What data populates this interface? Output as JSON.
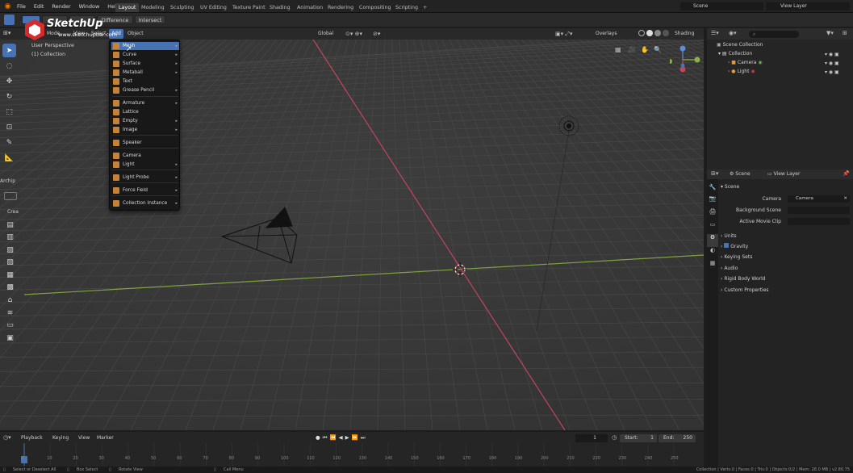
{
  "menubar": {
    "items": [
      "File",
      "Edit",
      "Render",
      "Window",
      "Help"
    ]
  },
  "workspace_tabs": [
    "Layout",
    "Modeling",
    "Sculpting",
    "UV Editing",
    "Texture Paint",
    "Shading",
    "Animation",
    "Rendering",
    "Compositing",
    "Scripting",
    "+"
  ],
  "scene": {
    "label": "Scene",
    "view_layer": "View Layer"
  },
  "toolrow": {
    "bool_buttons": [
      "Difference",
      "Intersect"
    ]
  },
  "logo": {
    "brand": "SketchUp",
    "url": "www.sketchupbar.com"
  },
  "viewport_header": {
    "mode": "Mode",
    "menus": [
      "View",
      "Select",
      "Add",
      "Object"
    ],
    "transform": "Global",
    "overlays": "Overlays",
    "shading": "Shading"
  },
  "viewport": {
    "perspective": "User Perspective",
    "collection": "(1) Collection"
  },
  "side_panels": {
    "arch": "Archip",
    "create": "Crea"
  },
  "add_menu": {
    "items": [
      {
        "label": "Mesh",
        "icon": "mesh-icon",
        "submenu": true,
        "highlight": true
      },
      {
        "label": "Curve",
        "icon": "curve-icon",
        "submenu": true
      },
      {
        "label": "Surface",
        "icon": "surface-icon",
        "submenu": true
      },
      {
        "label": "Metaball",
        "icon": "metaball-icon",
        "submenu": true
      },
      {
        "label": "Text",
        "icon": "text-icon",
        "submenu": false
      },
      {
        "label": "Grease Pencil",
        "icon": "grease-pencil-icon",
        "submenu": true
      },
      {
        "label": "Armature",
        "icon": "armature-icon",
        "submenu": true
      },
      {
        "label": "Lattice",
        "icon": "lattice-icon",
        "submenu": false
      },
      {
        "label": "Empty",
        "icon": "empty-icon",
        "submenu": true
      },
      {
        "label": "Image",
        "icon": "image-icon",
        "submenu": true
      },
      {
        "label": "Speaker",
        "icon": "speaker-icon",
        "submenu": false
      },
      {
        "label": "Camera",
        "icon": "camera-icon",
        "submenu": false
      },
      {
        "label": "Light",
        "icon": "light-icon",
        "submenu": true
      },
      {
        "label": "Light Probe",
        "icon": "light-probe-icon",
        "submenu": true
      },
      {
        "label": "Force Field",
        "icon": "force-field-icon",
        "submenu": true
      },
      {
        "label": "Collection Instance",
        "icon": "collection-instance-icon",
        "submenu": true
      }
    ]
  },
  "outliner": {
    "scene_collection": "Scene Collection",
    "collection": "Collection",
    "camera": "Camera",
    "light": "Light"
  },
  "properties": {
    "tab_scene": "Scene",
    "tab_view_layer": "View Layer",
    "section": "Scene",
    "camera_label": "Camera",
    "camera_value": "Camera",
    "bg_scene_label": "Background Scene",
    "movie_clip_label": "Active Movie Clip",
    "panels": [
      "Units",
      "Gravity",
      "Keying Sets",
      "Audio",
      "Rigid Body World",
      "Custom Properties"
    ]
  },
  "timeline": {
    "menus": [
      "Playback",
      "Keying",
      "View",
      "Marker"
    ],
    "current_frame": "1",
    "start_label": "Start:",
    "start": "1",
    "end_label": "End:",
    "end": "250",
    "ticks": [
      "0",
      "10",
      "20",
      "30",
      "40",
      "50",
      "60",
      "70",
      "80",
      "90",
      "100",
      "110",
      "120",
      "130",
      "140",
      "150",
      "160",
      "170",
      "180",
      "190",
      "200",
      "210",
      "220",
      "230",
      "240",
      "250"
    ]
  },
  "statusbar": {
    "left": "Select or Deselect All",
    "mid": "Box Select",
    "rotate": "Rotate View",
    "call": "Call Menu",
    "right": "Collection | Verts:0 | Faces:0 | Tris:0 | Objects:0/2 | Mem: 28.0 MB | v2.80.75"
  },
  "colors": {
    "accent": "#4772b3",
    "xaxis": "#c1465a",
    "yaxis": "#8ab04b",
    "icon_orange": "#c68338"
  }
}
